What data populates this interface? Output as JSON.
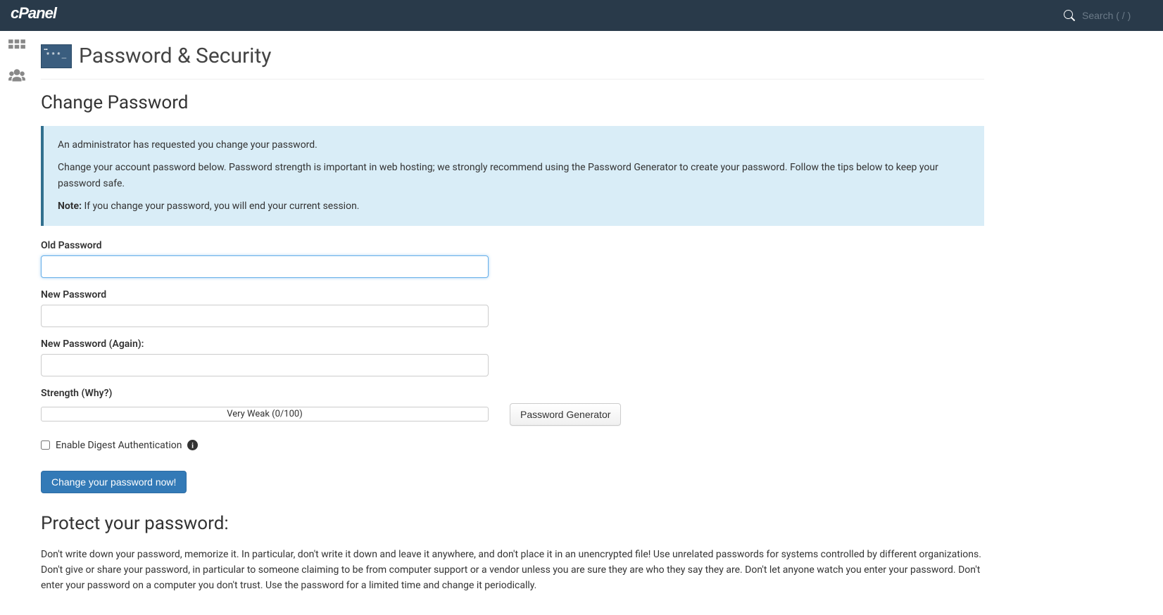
{
  "header": {
    "logo": "cPanel",
    "search_placeholder": "Search ( / )"
  },
  "page": {
    "title": "Password & Security",
    "icon_text": "***_"
  },
  "change_password": {
    "heading": "Change Password",
    "alert": {
      "line1": "An administrator has requested you change your password.",
      "line2": "Change your account password below. Password strength is important in web hosting; we strongly recommend using the Password Generator to create your password. Follow the tips below to keep your password safe.",
      "note_label": "Note:",
      "note_text": " If you change your password, you will end your current session."
    },
    "fields": {
      "old_password_label": "Old Password",
      "new_password_label": "New Password",
      "new_password_again_label": "New Password (Again):",
      "strength_label": "Strength (Why?)",
      "strength_value": "Very Weak (0/100)",
      "password_generator_button": "Password Generator"
    },
    "digest": {
      "label": "Enable Digest Authentication"
    },
    "submit_button": "Change your password now!"
  },
  "protect": {
    "heading": "Protect your password:",
    "text": "Don't write down your password, memorize it. In particular, don't write it down and leave it anywhere, and don't place it in an unencrypted file! Use unrelated passwords for systems controlled by different organizations. Don't give or share your password, in particular to someone claiming to be from computer support or a vendor unless you are sure they are who they say they are. Don't let anyone watch you enter your password. Don't enter your password on a computer you don't trust. Use the password for a limited time and change it periodically."
  }
}
